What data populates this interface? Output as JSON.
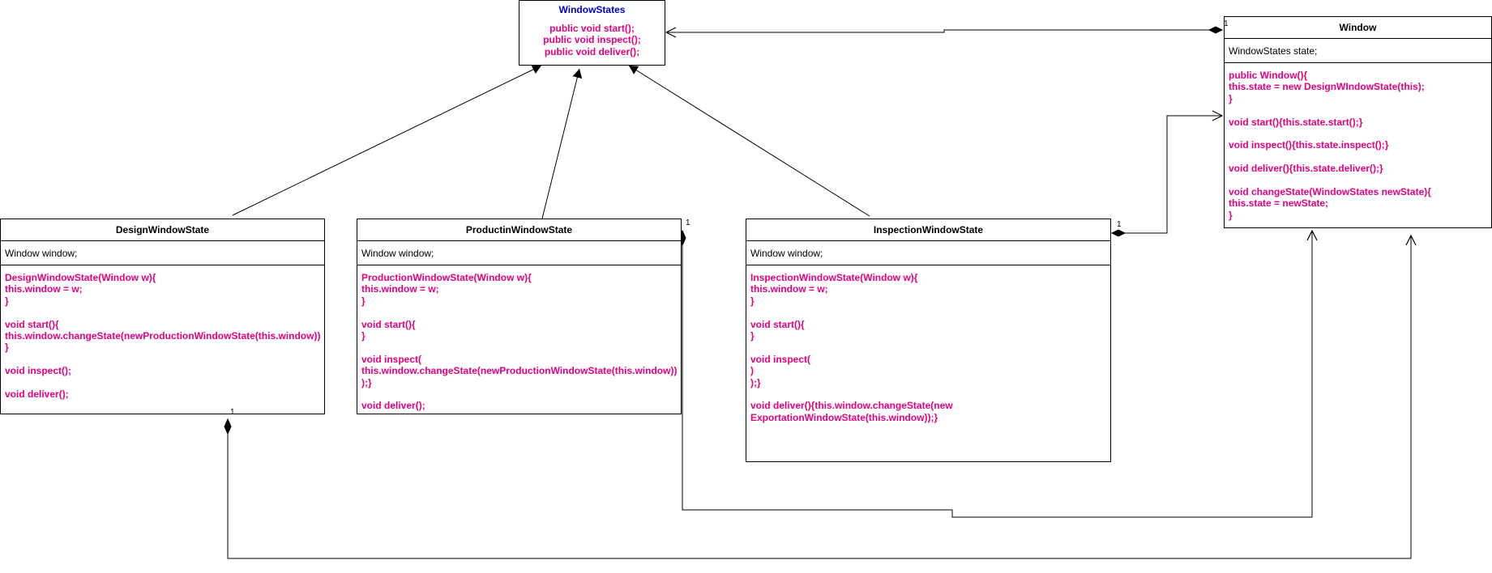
{
  "interface": {
    "name": "WindowStates",
    "operations": "public void start();\npublic void inspect();\npublic void deliver();"
  },
  "window": {
    "name": "Window",
    "attribute": "WindowStates state;",
    "operations": "public Window(){\nthis.state = new DesignWIndowState(this);\n}\n\nvoid start(){this.state.start();}\n\nvoid inspect(){this.state.inspect();}\n\nvoid deliver(){this.state.deliver();}\n\nvoid changeState(WindowStates newState){\nthis.state = newState;\n}"
  },
  "design": {
    "name": "DesignWindowState",
    "attribute": "Window window;",
    "operations": "DesignWindowState(Window w){\nthis.window = w;\n}\n\nvoid start(){\nthis.window.changeState(newProductionWindowState(this.window))\n}\n\nvoid inspect();\n\nvoid deliver();"
  },
  "production": {
    "name": "ProductinWindowState",
    "attribute": "Window window;",
    "operations": "ProductionWindowState(Window w){\nthis.window = w;\n}\n\nvoid start(){\n}\n\nvoid inspect(\nthis.window.changeState(newProductionWindowState(this.window))\n);}\n\nvoid deliver();"
  },
  "inspection": {
    "name": "InspectionWindowState",
    "attribute": "Window window;",
    "operations": "InspectionWindowState(Window w){\nthis.window = w;\n}\n\nvoid start(){\n}\n\nvoid inspect(\n)\n);}\n\nvoid deliver(){this.window.changeState(new\nExportationWindowState(this.window));}"
  },
  "multiplicities": {
    "window_to_interface": "1",
    "production": "1",
    "inspection": "1",
    "design": "1"
  }
}
